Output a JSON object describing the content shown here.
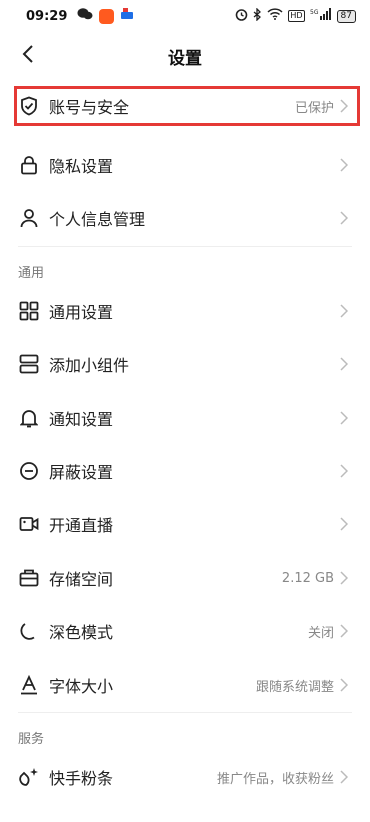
{
  "status_bar": {
    "time": "09:29",
    "battery": "87",
    "network": "HD",
    "signal_labels": "5G"
  },
  "header": {
    "title": "设置"
  },
  "account_items": [
    {
      "label": "账号与安全",
      "value": "已保护",
      "icon": "shield-check-icon"
    },
    {
      "label": "隐私设置",
      "value": "",
      "icon": "lock-icon"
    },
    {
      "label": "个人信息管理",
      "value": "",
      "icon": "person-icon"
    }
  ],
  "general": {
    "section_title": "通用",
    "items": [
      {
        "label": "通用设置",
        "value": "",
        "icon": "grid-icon"
      },
      {
        "label": "添加小组件",
        "value": "",
        "icon": "widget-icon"
      },
      {
        "label": "通知设置",
        "value": "",
        "icon": "bell-icon"
      },
      {
        "label": "屏蔽设置",
        "value": "",
        "icon": "block-icon"
      },
      {
        "label": "开通直播",
        "value": "",
        "icon": "camera-icon"
      },
      {
        "label": "存储空间",
        "value": "2.12 GB",
        "icon": "storage-icon"
      },
      {
        "label": "深色模式",
        "value": "关闭",
        "icon": "moon-icon"
      },
      {
        "label": "字体大小",
        "value": "跟随系统调整",
        "icon": "font-icon"
      }
    ]
  },
  "services": {
    "section_title": "服务",
    "items": [
      {
        "label": "快手粉条",
        "value": "推广作品，收获粉丝",
        "icon": "sparkle-icon"
      }
    ]
  },
  "colors": {
    "highlight": "#e53935",
    "value_text": "#888888",
    "chevron": "#bbbbbb"
  }
}
